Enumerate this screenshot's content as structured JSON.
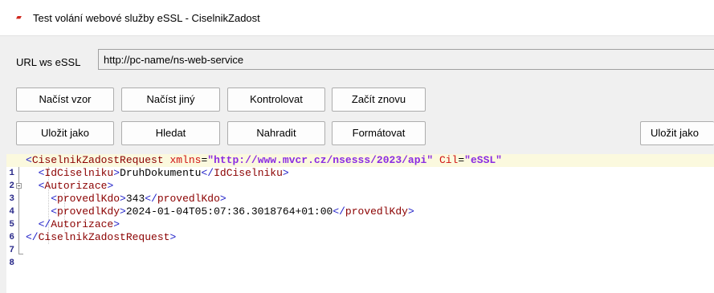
{
  "window": {
    "title": "Test volání webové služby eSSL - CiselnikZadost",
    "icon": "app-logo-icon"
  },
  "url": {
    "label": "URL ws eSSL",
    "value": "http://pc-name/ns-web-service"
  },
  "toolbar": {
    "row1": [
      "Načíst vzor",
      "Načíst jiný",
      "Kontrolovat",
      "Začít znovu"
    ],
    "row2": [
      "Uložit jako",
      "Hledat",
      "Nahradit",
      "Formátovat"
    ],
    "save_as_right": "Uložit jako"
  },
  "editor": {
    "line_numbers": [
      "1",
      "2",
      "3",
      "4",
      "5",
      "6",
      "7",
      "8"
    ],
    "lines": [
      "<CiselnikZadostRequest xmlns=\"http://www.mvcr.cz/nsesss/2023/api\" Cil=\"eSSL\"",
      "  <IdCiselniku>DruhDokumentu</IdCiselniku>",
      "  <Autorizace>",
      "    <provedlKdo>343</provedlKdo>",
      "    <provedlKdy>2024-01-04T05:07:36.3018764+01:00</provedlKdy>",
      "  </Autorizace>",
      "</CiselnikZadostRequest>",
      ""
    ],
    "colors": {
      "bracket": "#1e1ec8",
      "tag_name": "#8b0000",
      "attribute": "#d01010",
      "attribute_value": "#8a2be2",
      "current_line": "#fbf9de"
    }
  }
}
